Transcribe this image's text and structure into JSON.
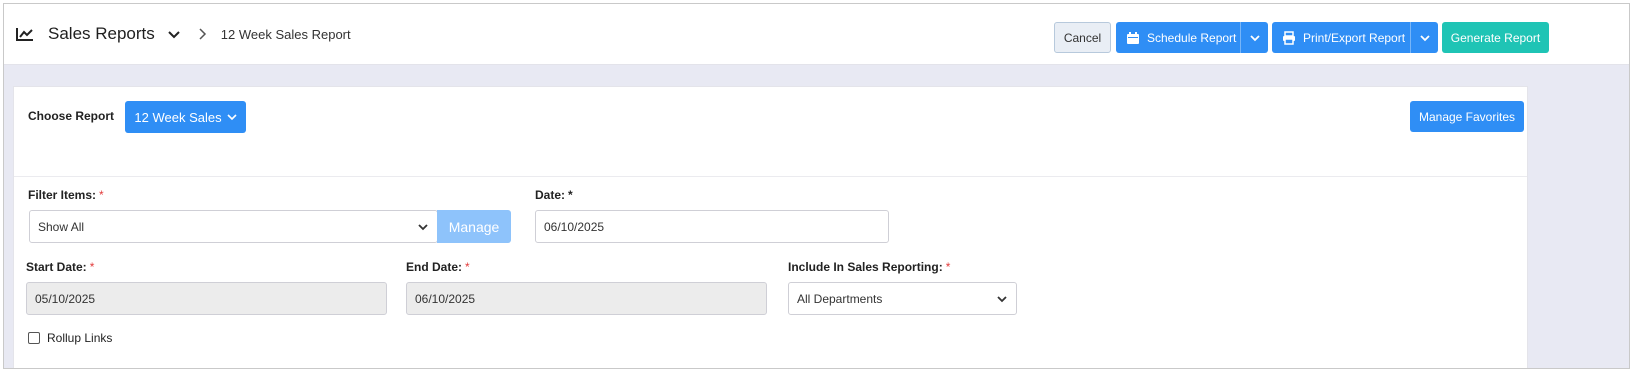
{
  "header": {
    "section_title": "Sales Reports",
    "current_page": "12 Week Sales Report",
    "cancel_label": "Cancel",
    "schedule_label": "Schedule Report",
    "print_label": "Print/Export Report",
    "generate_label": "Generate Report"
  },
  "report": {
    "choose_label": "Choose Report",
    "selected_report": "12 Week Sales",
    "favorites_label": "Manage Favorites"
  },
  "filters": {
    "filter_items_label": "Filter Items:",
    "filter_items_value": "Show All",
    "manage_label": "Manage",
    "date_label": "Date:",
    "date_value": "06/10/2025",
    "start_date_label": "Start Date:",
    "start_date_value": "05/10/2025",
    "end_date_label": "End Date:",
    "end_date_value": "06/10/2025",
    "include_label": "Include In Sales Reporting:",
    "include_value": "All Departments",
    "rollup_label": "Rollup Links",
    "rollup_checked": false,
    "required_mark": "*"
  },
  "colors": {
    "primary": "#2f8ef5",
    "teal": "#1fc4b5",
    "required": "#e23b3b"
  },
  "icons": {
    "header": "chart-line-icon",
    "schedule": "calendar-icon",
    "print": "printer-icon"
  }
}
